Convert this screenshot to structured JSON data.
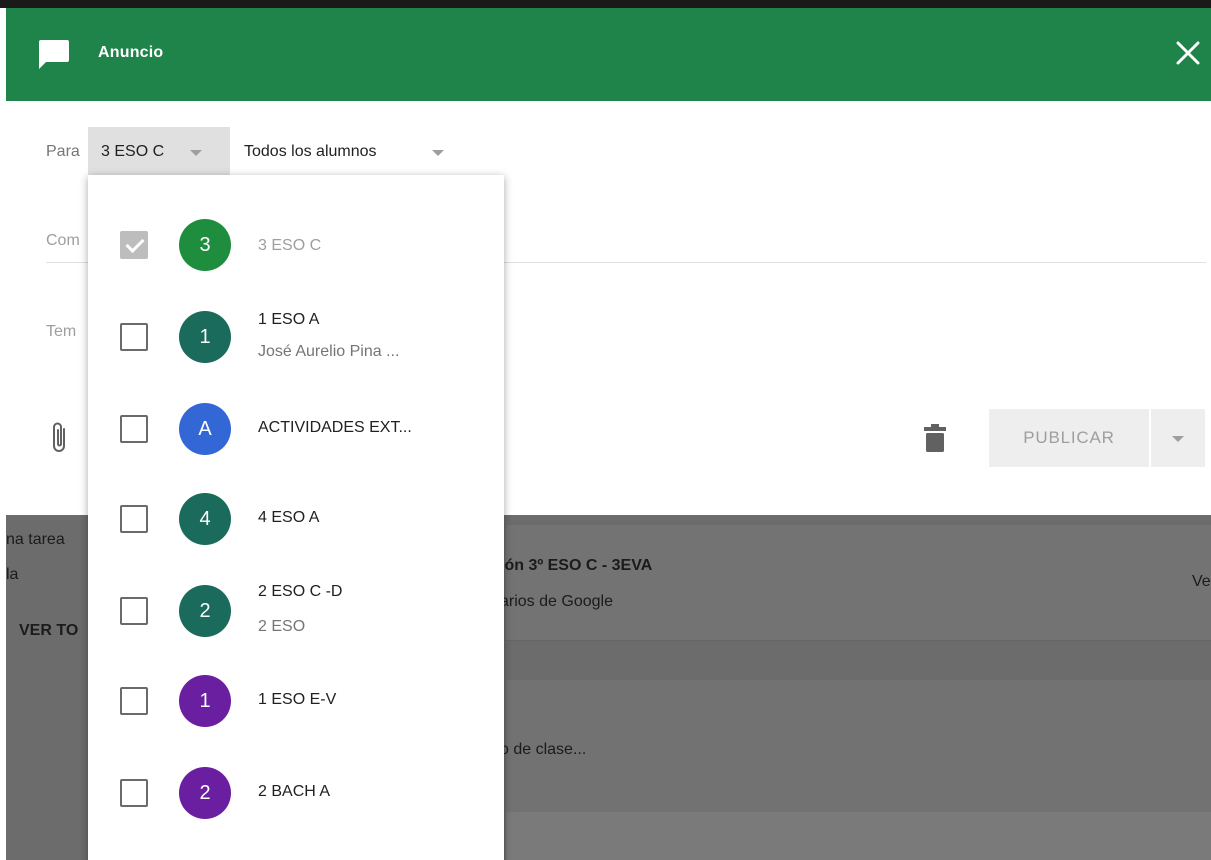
{
  "header": {
    "title": "Anuncio"
  },
  "para": {
    "label": "Para",
    "class_value": "3 ESO C",
    "students_value": "Todos los alumnos"
  },
  "form": {
    "comment_placeholder": "Com",
    "topic_placeholder": "Tem",
    "publish_label": "PUBLICAR"
  },
  "background_stream": {
    "left_line1": "na tarea",
    "left_line2": "la",
    "left_link": "VER TO",
    "card_title": "ión 3º ESO C - 3EVA",
    "card_sub": "arios de Google",
    "card_right": "Ve",
    "card2_text": "o de clase..."
  },
  "menu": {
    "items": [
      {
        "label": "3 ESO C",
        "subtitle": "",
        "avatar_text": "3",
        "avatar_color": "#1e8e3e",
        "checked": true,
        "disabled": true
      },
      {
        "label": "1 ESO A",
        "subtitle": "José Aurelio Pina ...",
        "avatar_text": "1",
        "avatar_color": "#1a6b5b",
        "checked": false,
        "disabled": false
      },
      {
        "label": "ACTIVIDADES EXT...",
        "subtitle": "",
        "avatar_text": "A",
        "avatar_color": "#3367d6",
        "checked": false,
        "disabled": false
      },
      {
        "label": "4 ESO A",
        "subtitle": "",
        "avatar_text": "4",
        "avatar_color": "#1a6b5b",
        "checked": false,
        "disabled": false
      },
      {
        "label": "2 ESO C -D",
        "subtitle": "2 ESO",
        "avatar_text": "2",
        "avatar_color": "#1a6b5b",
        "checked": false,
        "disabled": false
      },
      {
        "label": "1 ESO E-V",
        "subtitle": "",
        "avatar_text": "1",
        "avatar_color": "#6a1fa0",
        "checked": false,
        "disabled": false
      },
      {
        "label": "2 BACH A",
        "subtitle": "",
        "avatar_text": "2",
        "avatar_color": "#6a1fa0",
        "checked": false,
        "disabled": false
      }
    ]
  },
  "colors": {
    "header_green": "#1e8449",
    "dim_overlay": "#6c6c6c"
  },
  "icons": [
    "chat-bubble-icon",
    "close-icon",
    "paperclip-icon",
    "trash-icon",
    "chevron-down-icon",
    "checkbox-icon"
  ]
}
